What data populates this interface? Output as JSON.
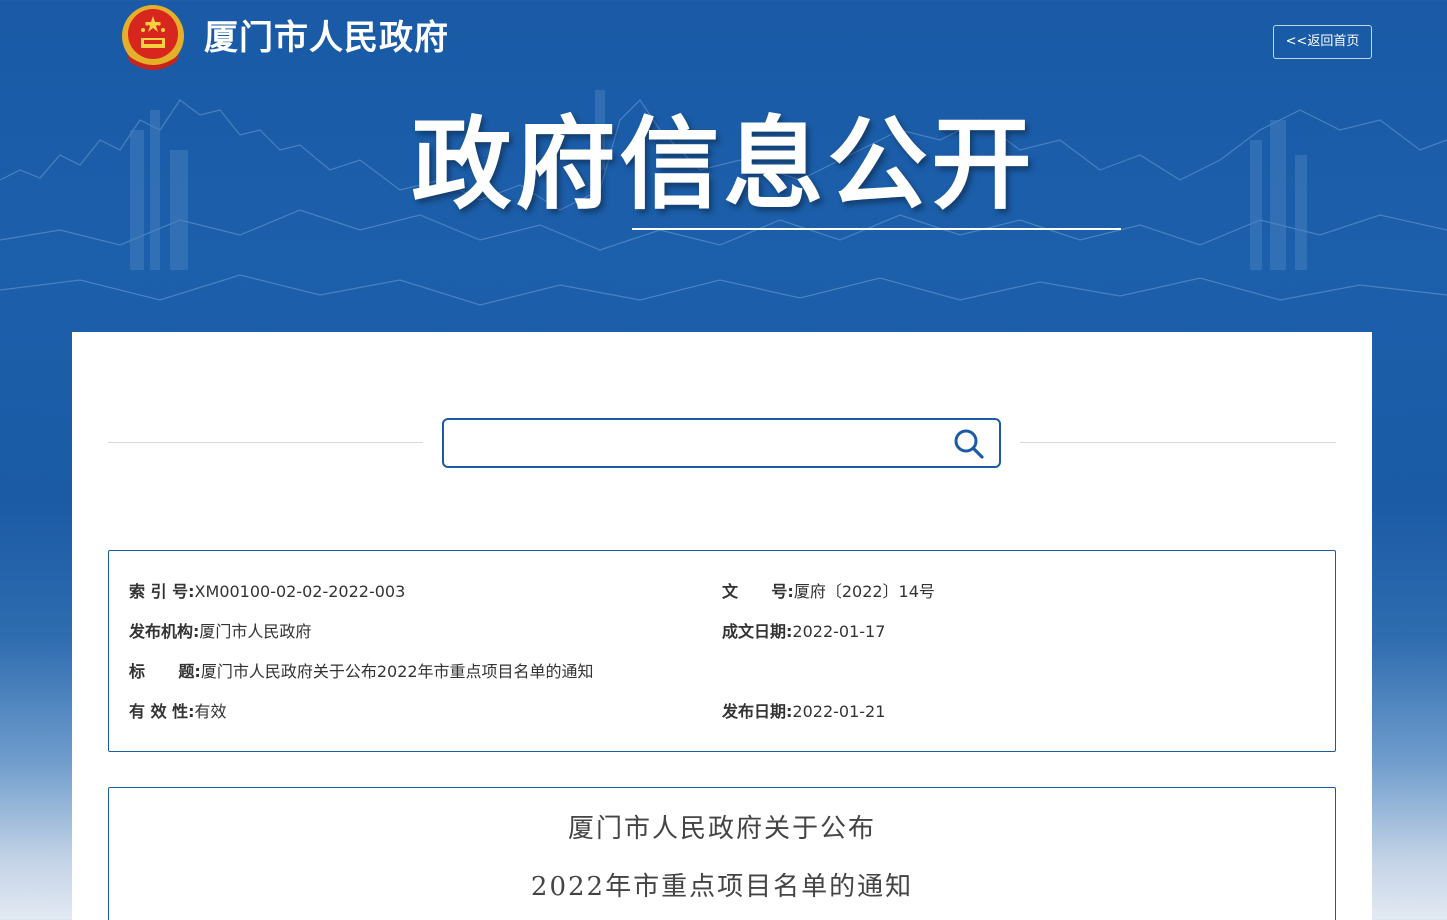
{
  "header": {
    "site_name": "厦门市人民政府",
    "back_home": "<<返回首页",
    "hero_title": "政府信息公开"
  },
  "search": {
    "value": "",
    "placeholder": ""
  },
  "meta": {
    "index_no": {
      "label": "索 引 号:",
      "value": "XM00100-02-02-2022-003"
    },
    "doc_no": {
      "label": "文      号:",
      "value": "厦府〔2022〕14号"
    },
    "issuer": {
      "label": "发布机构:",
      "value": "厦门市人民政府"
    },
    "written_date": {
      "label": "成文日期:",
      "value": "2022-01-17"
    },
    "title": {
      "label": "标      题:",
      "value": "厦门市人民政府关于公布2022年市重点项目名单的通知"
    },
    "validity": {
      "label": "有 效 性:",
      "value": "有效"
    },
    "publish_date": {
      "label": "发布日期:",
      "value": "2022-01-21"
    }
  },
  "document": {
    "title_line1": "厦门市人民政府关于公布",
    "title_line2": "2022年市重点项目名单的通知"
  },
  "colors": {
    "brand_blue": "#1b5ba6",
    "panel_bg": "#ffffff"
  }
}
